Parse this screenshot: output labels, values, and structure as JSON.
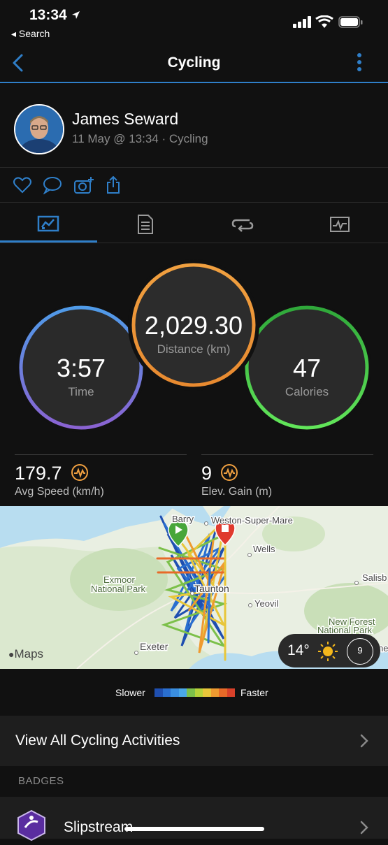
{
  "status_bar": {
    "time": "13:34",
    "back_label": "◂ Search"
  },
  "nav": {
    "title": "Cycling"
  },
  "profile": {
    "name": "James Seward",
    "subtitle": "11 May @ 13:34 · Cycling"
  },
  "actions": [
    "heart-icon",
    "comment-icon",
    "camera-add-icon",
    "share-icon"
  ],
  "tabs": [
    "summary-icon",
    "details-icon",
    "laps-icon",
    "chart-icon"
  ],
  "summary": {
    "time": {
      "value": "3:57",
      "label": "Time"
    },
    "distance": {
      "value": "2,029.30",
      "label": "Distance (km)"
    },
    "calories": {
      "value": "47",
      "label": "Calories"
    }
  },
  "stats": {
    "avg_speed": {
      "value": "179.7",
      "label": "Avg Speed (km/h)"
    },
    "elev_gain": {
      "value": "9",
      "label": "Elev. Gain (m)"
    }
  },
  "map": {
    "places": [
      "Barry",
      "Weston-Super-Mare",
      "Wells",
      "Exmoor",
      "National Park",
      "Taunton",
      "Yeovil",
      "Salisb",
      "New Forest",
      "National Park",
      "Exeter",
      "ne"
    ],
    "attribution": "Maps",
    "weather_temp": "14°",
    "wind": "9"
  },
  "legend": {
    "slower": "Slower",
    "faster": "Faster",
    "colors": [
      "#1f4fb0",
      "#2a6fd0",
      "#3a8ee0",
      "#4aa8e8",
      "#7cc04a",
      "#b6d23a",
      "#e8c63a",
      "#ef9a30",
      "#e86a28",
      "#d9412a"
    ]
  },
  "links": {
    "view_all": "View All Cycling Activities"
  },
  "badges": {
    "header": "BADGES",
    "item": "Slipstream"
  },
  "colors": {
    "accent": "#2f7fc9",
    "time_ring": "#5b8fe0",
    "distance_ring": "#f0a040",
    "calories_ring": "#4fd04a"
  }
}
